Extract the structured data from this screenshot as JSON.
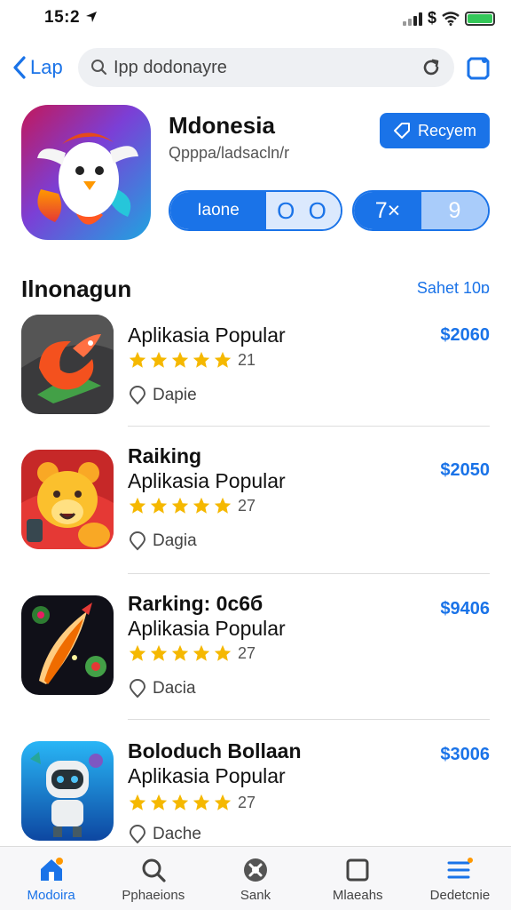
{
  "status_bar": {
    "time": "15:2"
  },
  "header": {
    "back_label": "Lap",
    "search_text": "Ipp dodonayre"
  },
  "featured": {
    "title": "Mdonesia",
    "subtitle": "Qpppa/ladsacln/r",
    "get_label": "Recyem",
    "pill1_label": "Iaone",
    "pill1_value": "O O",
    "pill2_label": "7×",
    "pill2_value": "9"
  },
  "section": {
    "title": "Ilnonagun",
    "link": "Sahet 10ɒ"
  },
  "apps": [
    {
      "name": "",
      "subtitle": "Aplikasia  Popular",
      "rating": "21",
      "place": "Dapie",
      "price": "$2060"
    },
    {
      "name": "Raiking",
      "subtitle": "Aplikasia Popular",
      "rating": "27",
      "place": "Dagia",
      "price": "$2050"
    },
    {
      "name": "Rarking: 0c6б",
      "subtitle": "Aplikasia Popular",
      "rating": "27",
      "place": "Dacia",
      "price": "$9406"
    },
    {
      "name": "Boloduch Bollaan",
      "subtitle": "Aplikasia Popular",
      "rating": "27",
      "place": "Dache",
      "price": "$3006"
    }
  ],
  "tabs": [
    {
      "label": "Modoira",
      "icon": "home-icon",
      "active": true
    },
    {
      "label": "Pphaeions",
      "icon": "search-icon",
      "active": false
    },
    {
      "label": "Sank",
      "icon": "game-icon",
      "active": false
    },
    {
      "label": "Mlaeahs",
      "icon": "square-icon",
      "active": false
    },
    {
      "label": "Dedetcnie",
      "icon": "menu-icon",
      "active": false
    }
  ],
  "colors": {
    "accent": "#1a73e8",
    "star": "#f5b800",
    "battery": "#34c759"
  }
}
